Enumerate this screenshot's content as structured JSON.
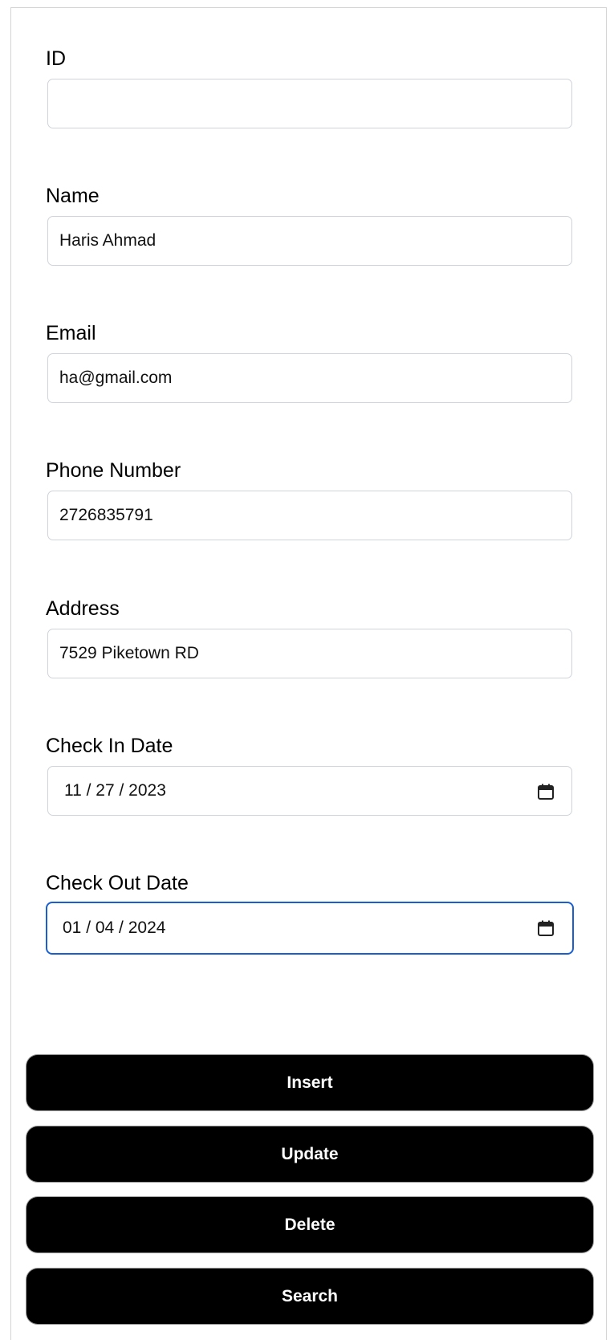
{
  "form": {
    "fields": [
      {
        "label": "ID",
        "value": ""
      },
      {
        "label": "Name",
        "value": "Haris Ahmad"
      },
      {
        "label": "Email",
        "value": "ha@gmail.com"
      },
      {
        "label": "Phone Number",
        "value": "2726835791"
      },
      {
        "label": "Address",
        "value": "7529 Piketown RD"
      },
      {
        "label": "Check In Date",
        "value": "11 / 27 / 2023"
      },
      {
        "label": "Check Out Date",
        "value": "01 / 04 / 2024"
      }
    ],
    "focused_field": "Check Out Date"
  },
  "buttons": {
    "insert": "Insert",
    "update": "Update",
    "delete": "Delete",
    "search": "Search"
  },
  "icons": {
    "date_picker": "calendar-icon"
  },
  "colors": {
    "button_bg": "#000000",
    "button_text": "#ffffff",
    "focus_border": "#1a5fd0",
    "input_border": "#cfd4da"
  }
}
